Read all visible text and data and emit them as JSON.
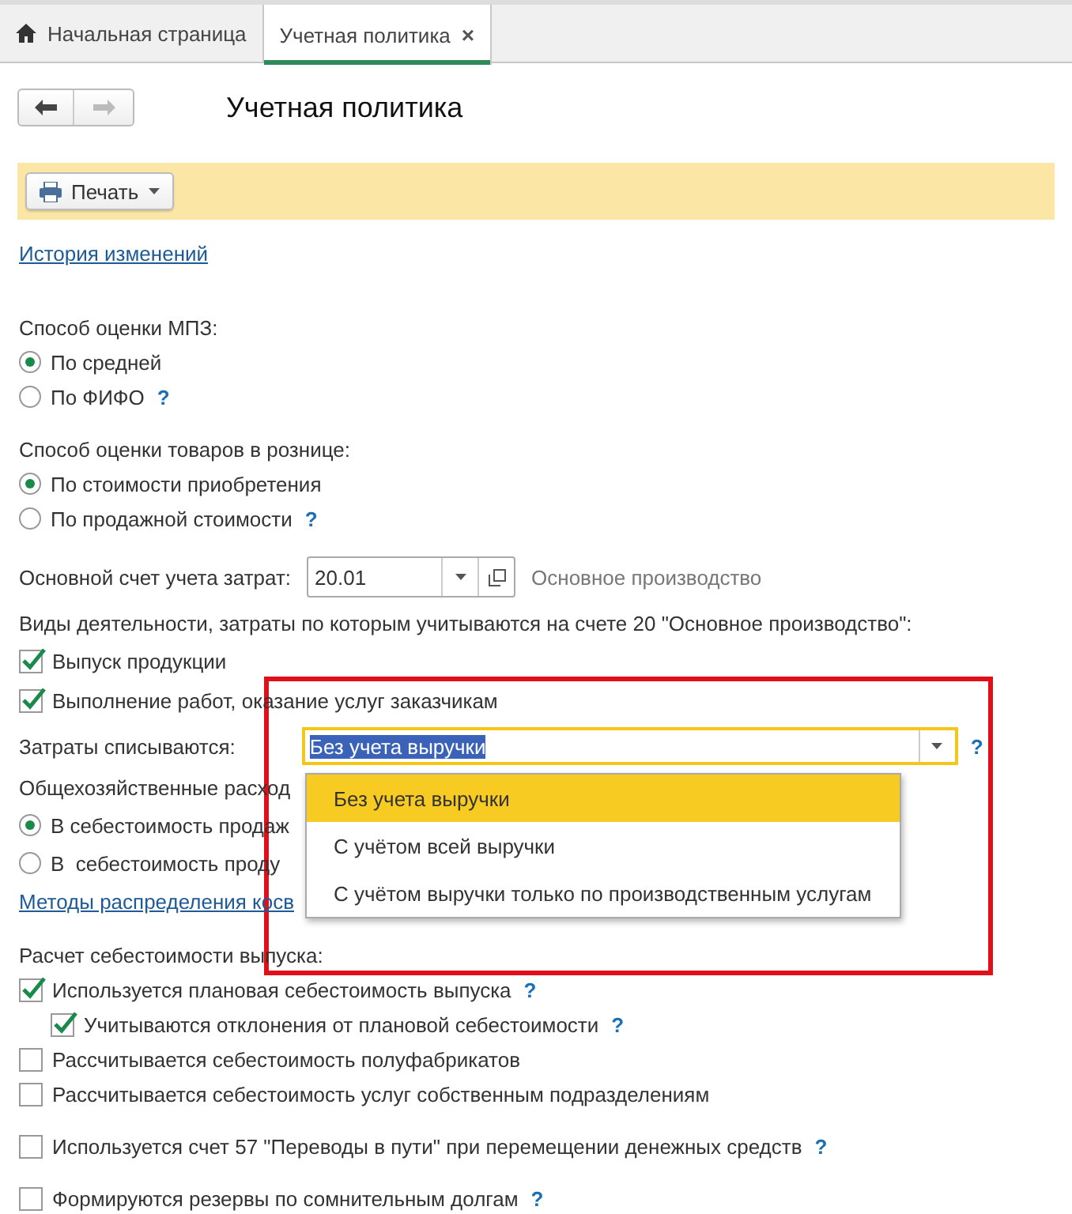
{
  "tabs": [
    {
      "label": "Начальная страница",
      "kind": "home",
      "selected": false
    },
    {
      "label": "Учетная политика",
      "kind": "closable",
      "selected": true,
      "close": "×"
    }
  ],
  "nav": {
    "back_disabled": false,
    "forward_disabled": true
  },
  "title": "Учетная политика",
  "toolbar": {
    "print_button": "Печать"
  },
  "history_link": "История изменений",
  "groups": [
    {
      "items": [
        {
          "kind": "label",
          "text": "Способ оценки МПЗ:"
        },
        {
          "kind": "radio",
          "label": "По средней",
          "selected": true
        },
        {
          "kind": "radio",
          "label": "По ФИФО",
          "selected": false,
          "help": "?"
        }
      ]
    },
    {
      "items": [
        {
          "kind": "label",
          "text": "Способ оценки товаров в рознице:"
        },
        {
          "kind": "radio",
          "label": "По стоимости приобретения",
          "selected": true
        },
        {
          "kind": "radio",
          "label": "По продажной стоимости",
          "selected": false,
          "help": "?"
        }
      ]
    },
    {
      "items": [
        {
          "kind": "account",
          "label": "Основной счет учета затрат:",
          "value": "20.01",
          "hint": "Основное производство"
        },
        {
          "kind": "label",
          "text": "Виды деятельности, затраты по которым учитываются на счете 20 \"Основное производство\":"
        },
        {
          "kind": "check",
          "label": "Выпуск продукции",
          "checked": true
        },
        {
          "kind": "check",
          "label": "Выполнение работ, оказание услуг заказчикам",
          "checked": true
        },
        {
          "kind": "select",
          "label": "Затраты списываются:",
          "value": "Без учета выручки",
          "help": "?",
          "focused": true
        },
        {
          "kind": "label",
          "text": "Общехозяйственные расход"
        },
        {
          "kind": "radio",
          "label": "В себестоимость продаж",
          "selected": true
        },
        {
          "kind": "radio",
          "label": "В  себестоимость проду",
          "selected": false
        },
        {
          "kind": "link",
          "text": "Методы распределения косв"
        }
      ]
    },
    {
      "items": [
        {
          "kind": "label",
          "text": "Расчет себестоимости выпуска:"
        },
        {
          "kind": "check",
          "label": "Используется плановая себестоимость выпуска",
          "checked": true,
          "help": "?",
          "children": [
            {
              "kind": "check",
              "label": "Учитываются отклонения от плановой себестоимости",
              "checked": true,
              "help": "?"
            }
          ]
        },
        {
          "kind": "check",
          "label": "Рассчитывается себестоимость полуфабрикатов",
          "checked": false
        },
        {
          "kind": "check",
          "label": "Рассчитывается себестоимость услуг собственным подразделениям",
          "checked": false
        }
      ]
    },
    {
      "items": [
        {
          "kind": "check",
          "label": "Используется счет 57 \"Переводы в пути\" при перемещении денежных средств",
          "checked": false,
          "help": "?"
        }
      ]
    },
    {
      "items": [
        {
          "kind": "check",
          "label": "Формируются резервы по сомнительным долгам",
          "checked": false,
          "help": "?"
        }
      ]
    }
  ],
  "dropdown": {
    "options": [
      {
        "label": "Без учета выручки",
        "selected": true
      },
      {
        "label": "С учётом всей выручки",
        "selected": false
      },
      {
        "label": "С учётом выручки только по производственным услугам",
        "selected": false
      }
    ]
  },
  "highlight_frame": {
    "shown": true
  }
}
